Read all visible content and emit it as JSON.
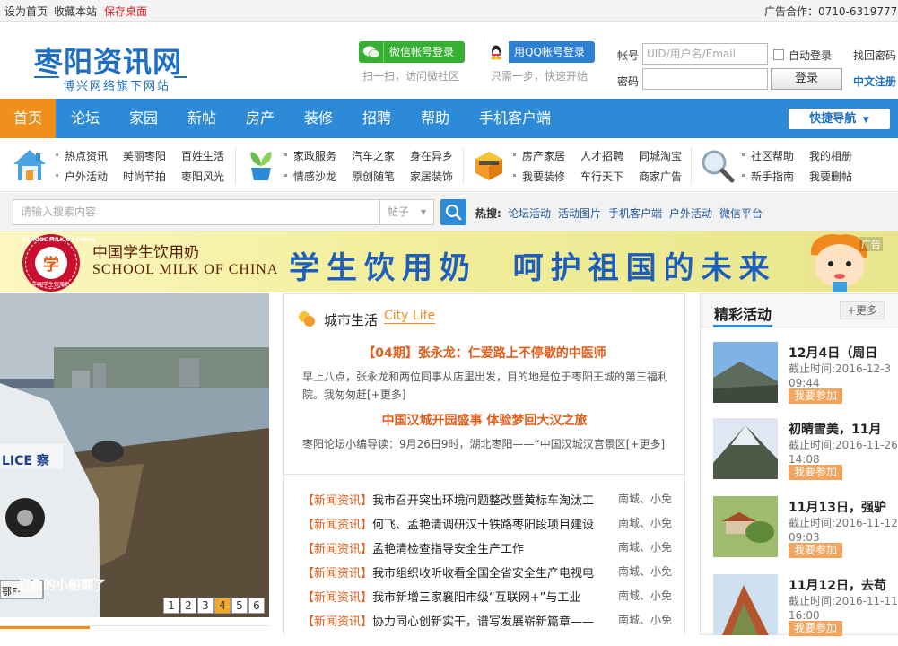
{
  "topbar": {
    "set_home": "设为首页",
    "bookmark": "收藏本站",
    "save_desktop": "保存桌面",
    "ad_contact": "广告合作：0710-6319777"
  },
  "header": {
    "logo_title": "枣阳资讯网",
    "logo_subtitle": "博兴网络旗下网站",
    "wechat_login": "微信帐号登录",
    "wechat_hint": "扫一扫，访问微社区",
    "qq_login": "用QQ帐号登录",
    "qq_hint": "只需一步，快速开始",
    "account_label": "帐号",
    "account_placeholder": "UID/用户名/Email",
    "auto_login": "自动登录",
    "forgot_password": "找回密码",
    "password_label": "密码",
    "login_button": "登录",
    "register": "中文注册"
  },
  "nav": {
    "items": [
      "首页",
      "论坛",
      "家园",
      "新帖",
      "房产",
      "装修",
      "招聘",
      "帮助",
      "手机客户端"
    ],
    "quick_nav": "快捷导航"
  },
  "subnav": {
    "groups": [
      [
        "热点资讯",
        "美丽枣阳",
        "百姓生活",
        "户外活动",
        "时尚节拍",
        "枣阳风光"
      ],
      [
        "家政服务",
        "汽车之家",
        "身在异乡",
        "情感沙龙",
        "原创随笔",
        "家居装饰"
      ],
      [
        "房产家居",
        "人才招聘",
        "同城淘宝",
        "我要装修",
        "车行天下",
        "商家广告"
      ],
      [
        "社区帮助",
        "我的相册",
        "新手指南",
        "我要删帖"
      ]
    ]
  },
  "search": {
    "placeholder": "请输入搜索内容",
    "scope": "帖子",
    "hot_label": "热搜:",
    "hot_links": [
      "论坛活动",
      "活动图片",
      "手机客户端",
      "户外活动",
      "微信平台"
    ]
  },
  "banner": {
    "ad_cn": "中国学生饮用奶",
    "ad_en": "SCHOOL MILK OF CHINA",
    "seal_top": "SCHOOL MILK OF CHINA",
    "seal_center": "学",
    "seal_bottom": "中国学生饮用奶",
    "slogan": "学生饮用奶  呵护祖国的未来",
    "ad_tag": "广告"
  },
  "slider": {
    "police_text": "LICE 察",
    "plate_text": "鄂F·",
    "caption": "打鱼的小船翻了",
    "pages": [
      "1",
      "2",
      "3",
      "4",
      "5",
      "6"
    ],
    "active_page": "4"
  },
  "city_life": {
    "title_cn": "城市生活",
    "title_en": "City Life",
    "headline1": "【04期】张永龙：仁爱路上不停歇的中医师",
    "summary1": "早上八点，张永龙和两位同事从店里出发，目的地是位于枣阳王城的第三福利院。我匆匆赶[+更多]",
    "headline2": "中国汉城开园盛事 体验梦回大汉之旅",
    "summary2": "枣阳论坛小编导读：9月26日9时，湖北枣阳——“中国汉城汉宫景区[+更多]"
  },
  "news": [
    {
      "tag": "【新闻资讯】",
      "title": "我市召开突出环境问题整改暨黄标车淘汰工",
      "author": "南城、小免"
    },
    {
      "tag": "【新闻资讯】",
      "title": "何飞、孟艳清调研汉十铁路枣阳段项目建设",
      "author": "南城、小免"
    },
    {
      "tag": "【新闻资讯】",
      "title": "孟艳清检查指导安全生产工作",
      "author": "南城、小免"
    },
    {
      "tag": "【新闻资讯】",
      "title": "我市组织收听收看全国全省安全生产电视电",
      "author": "南城、小免"
    },
    {
      "tag": "【新闻资讯】",
      "title": "我市新增三家襄阳市级“互联网+”与工业",
      "author": "南城、小免"
    },
    {
      "tag": "【新闻资讯】",
      "title": "协力同心创新实干，谱写发展崭新篇章——",
      "author": "南城、小免"
    }
  ],
  "activities": {
    "title": "精彩活动",
    "more": "+更多",
    "items": [
      {
        "title": "12月4日（周日",
        "deadline": "截止时间:2016-12-3 09:44",
        "join": "我要参加"
      },
      {
        "title": "初晴雪美，11月",
        "deadline": "截止时间:2016-11-26 14:08",
        "join": "我要参加"
      },
      {
        "title": "11月13日，强驴",
        "deadline": "截止时间:2016-11-12 09:03",
        "join": "我要参加"
      },
      {
        "title": "11月12日，去苟",
        "deadline": "截止时间:2016-11-11 16:00",
        "join": "我要参加"
      }
    ]
  }
}
